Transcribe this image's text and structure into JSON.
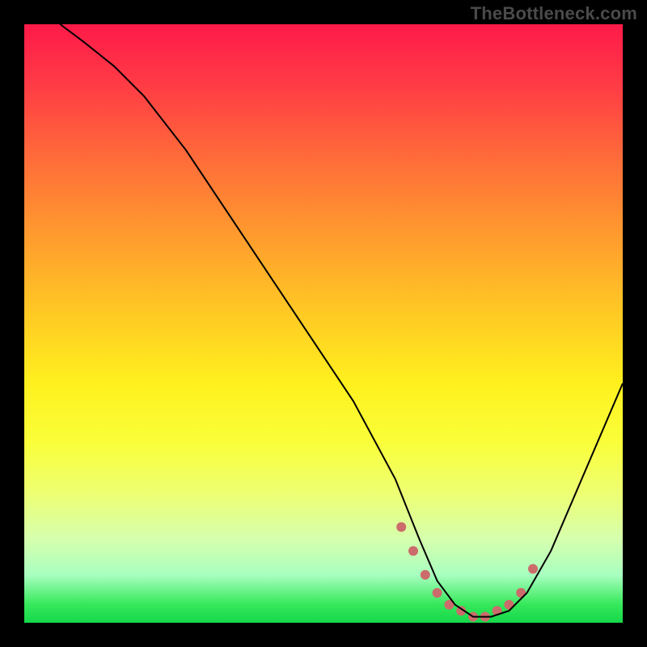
{
  "watermark": "TheBottleneck.com",
  "chart_data": {
    "type": "line",
    "title": "",
    "xlabel": "",
    "ylabel": "",
    "xlim": [
      0,
      100
    ],
    "ylim": [
      0,
      100
    ],
    "grid": false,
    "legend": false,
    "series": [
      {
        "name": "bottleneck-curve",
        "x": [
          6,
          10,
          15,
          20,
          27,
          35,
          45,
          55,
          62,
          66,
          69,
          72,
          75,
          78,
          81,
          84,
          88,
          100
        ],
        "y": [
          100,
          97,
          93,
          88,
          79,
          67,
          52,
          37,
          24,
          14,
          7,
          3,
          1,
          1,
          2,
          5,
          12,
          40
        ],
        "color": "#000000",
        "width": 2
      }
    ],
    "markers": {
      "name": "optimal-range-dots",
      "x": [
        63,
        65,
        67,
        69,
        71,
        73,
        75,
        77,
        79,
        81,
        83,
        85
      ],
      "y": [
        16,
        12,
        8,
        5,
        3,
        2,
        1,
        1,
        2,
        3,
        5,
        9
      ],
      "color": "#cc6b6b",
      "radius": 6
    },
    "background_gradient_note": "red-yellow-green vertical gradient, green at bottom"
  }
}
